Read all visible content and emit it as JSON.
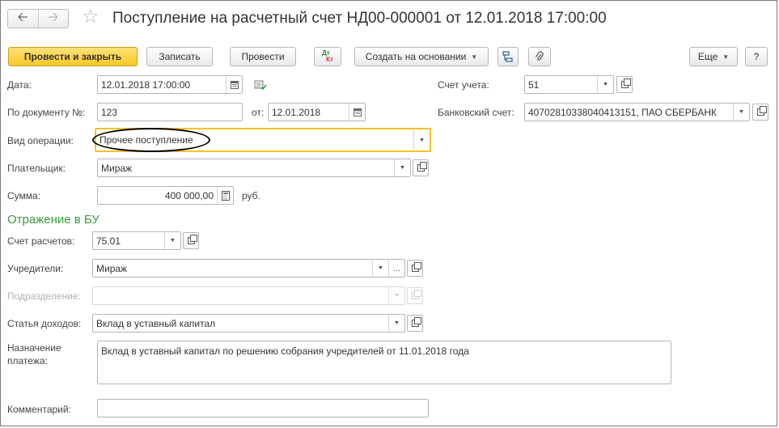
{
  "header": {
    "title": "Поступление на расчетный счет НД00-000001 от 12.01.2018 17:00:00",
    "back_icon": "arrow-left-icon",
    "forward_icon": "arrow-right-icon",
    "favorite_icon": "star-icon"
  },
  "toolbar": {
    "post_close_label": "Провести и закрыть",
    "save_label": "Записать",
    "post_label": "Провести",
    "dtkt_top": "Дт",
    "dtkt_bottom": "Кт",
    "create_based_label": "Создать на основании",
    "more_label": "Еще",
    "help_label": "?"
  },
  "form": {
    "date_label": "Дата:",
    "date_value": "12.01.2018 17:00:00",
    "account_label": "Счет учета:",
    "account_value": "51",
    "doc_number_label": "По документу №:",
    "doc_number_value": "123",
    "doc_date_label": "от:",
    "doc_date_value": "12.01.2018",
    "bank_account_label": "Банковский счет:",
    "bank_account_value": "40702810338040413151, ПАО СБЕРБАНК",
    "operation_label": "Вид операции:",
    "operation_value": "Прочее поступление",
    "payer_label": "Плательщик:",
    "payer_value": "Мираж",
    "amount_label": "Сумма:",
    "amount_value": "400 000,00",
    "currency": "руб."
  },
  "accounting": {
    "section_title": "Отражение в БУ",
    "settlement_account_label": "Счет расчетов:",
    "settlement_account_value": "75.01",
    "founders_label": "Учредители:",
    "founders_value": "Мираж",
    "division_label": "Подразделение:",
    "division_value": "",
    "income_item_label": "Статья доходов:",
    "income_item_value": "Вклад в уставный капитал",
    "purpose_label_line1": "Назначение",
    "purpose_label_line2": "платежа:",
    "purpose_value": "Вклад в уставный капитал по решению собрания учредителей от 11.01.2018 года",
    "comment_label": "Комментарий:",
    "comment_value": ""
  },
  "colors": {
    "primary_button": "#f6c826",
    "section_title": "#3a9a42",
    "focused_field_border": "#f4c22c"
  }
}
